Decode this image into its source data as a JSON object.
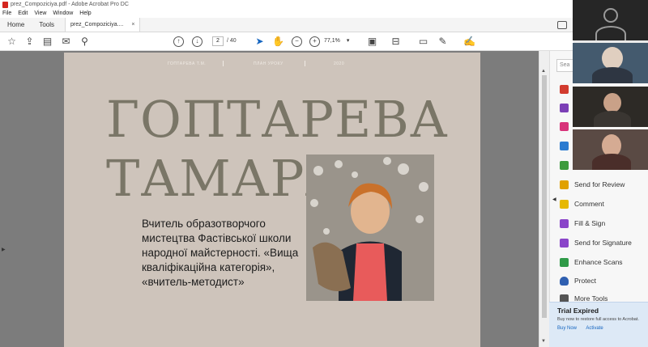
{
  "window": {
    "title": "prez_Compoziciya.pdf - Adobe Acrobat Pro DC",
    "menu": [
      "File",
      "Edit",
      "View",
      "Window",
      "Help"
    ]
  },
  "tabs": {
    "home": "Home",
    "tools": "Tools",
    "document": "prez_Compoziciya...."
  },
  "toolbar": {
    "current_page": "2",
    "page_total": "/ 40",
    "zoom": "77,1%",
    "icons": [
      "cloud-upload-icon",
      "print-icon",
      "mail-icon",
      "zoom-search-icon",
      "prev-page-icon",
      "next-page-icon",
      "select-cursor-icon",
      "hand-icon",
      "zoom-out-icon",
      "zoom-in-icon",
      "fit-page-icon",
      "scan-icon",
      "comment-icon",
      "pen-icon",
      "sign-icon"
    ]
  },
  "page": {
    "header_items": [
      "ГОПТАРЕВА Т.М.",
      "ПЛАН УРОКУ",
      "2020"
    ],
    "surname": "ГОПТАРЕВА",
    "first_name": "ТАМАРА",
    "bio": "Вчитель образотворчого мистецтва Фастівської школи народної майстерності. «Вища кваліфікаційна категорія», «вчитель-методист»",
    "background_color": "#cec4bb",
    "title_color": "#7a7667"
  },
  "right_panel": {
    "search_placeholder": "Sea",
    "tools": [
      {
        "label": "",
        "color": "#d23b2e"
      },
      {
        "label": "",
        "color": "#7b3fb6"
      },
      {
        "label": "",
        "color": "#d8327a"
      },
      {
        "label": "",
        "color": "#2b7bd0"
      },
      {
        "label": "",
        "color": "#3c9a3c"
      },
      {
        "label": "Send for Review",
        "color": "#e0a100"
      },
      {
        "label": "Comment",
        "color": "#e6b800"
      },
      {
        "label": "Fill & Sign",
        "color": "#8a45c9"
      },
      {
        "label": "Send for Signature",
        "color": "#8a45c9"
      },
      {
        "label": "Enhance Scans",
        "color": "#2f9a48"
      },
      {
        "label": "Protect",
        "color": "#2f5fb0"
      },
      {
        "label": "More Tools",
        "color": "#555555"
      }
    ],
    "trial": {
      "title": "Trial Expired",
      "message": "Buy now to restore full access to Acrobat.",
      "buy": "Buy Now",
      "activate": "Activate"
    }
  }
}
